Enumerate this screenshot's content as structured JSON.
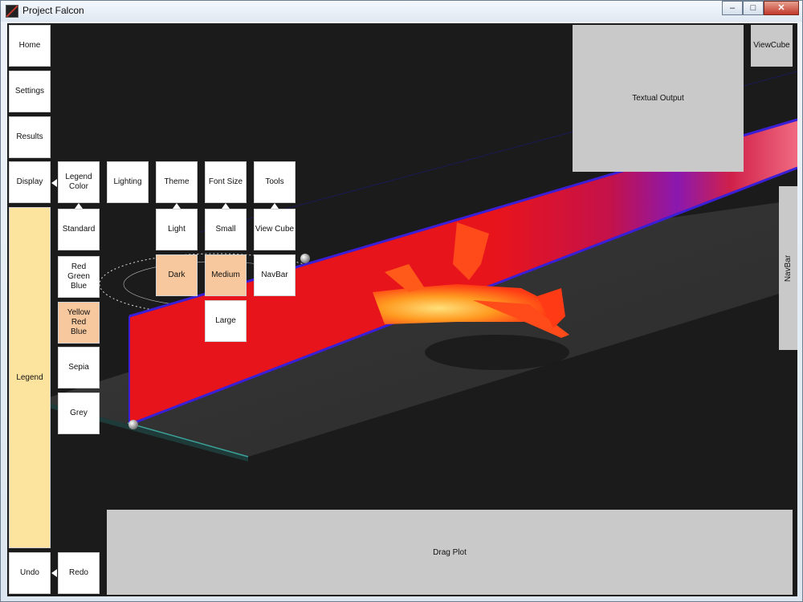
{
  "window": {
    "title": "Project Falcon",
    "minimize": "–",
    "maximize": "□",
    "close": "✕"
  },
  "menu": {
    "home": "Home",
    "settings": "Settings",
    "results": "Results",
    "display": "Display",
    "legend": "Legend",
    "undo": "Undo",
    "redo": "Redo"
  },
  "display_menu": {
    "legend_color": "Legend\nColor",
    "lighting": "Lighting",
    "theme": "Theme",
    "font_size": "Font Size",
    "tools": "Tools"
  },
  "legend_colors": [
    "Standard",
    "Red\nGreen\nBlue",
    "Yellow\nRed\nBlue",
    "Sepia",
    "Grey"
  ],
  "legend_color_selected": 2,
  "theme_options": [
    "Light",
    "Dark"
  ],
  "theme_selected": 1,
  "font_size_options": [
    "Small",
    "Medium",
    "Large"
  ],
  "font_size_selected": 1,
  "tools_options": [
    "View Cube",
    "NavBar"
  ],
  "panels": {
    "textual_output": "Textual Output",
    "viewcube": "ViewCube",
    "navbar": "NavBar",
    "drag_plot": "Drag Plot"
  },
  "colors": {
    "selected": "#f7c89e",
    "legend": "#fde49e",
    "panel": "#c9c9c9",
    "viewport_bg": "#1b1b1b",
    "contour_red": "#e8141c",
    "contour_blue": "#2a1fd6",
    "aircraft": "#ff4a1a"
  }
}
